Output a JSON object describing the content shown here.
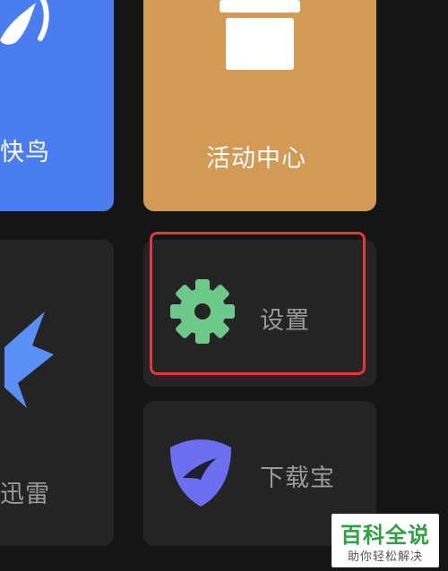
{
  "tiles": {
    "kuainiao": {
      "label": "快鸟",
      "icon": "kuainiao-bird-icon",
      "color": "#4a7ef0"
    },
    "activity": {
      "label": "活动中心",
      "icon": "gift-box-icon",
      "color": "#d39a55"
    },
    "xunlei": {
      "label": "迅雷",
      "icon": "xunlei-bird-icon",
      "color": "#242424"
    },
    "settings": {
      "label": "设置",
      "icon": "gear-icon",
      "accent": "#6dc98a"
    },
    "downloader": {
      "label": "下载宝",
      "icon": "download-shield-icon",
      "accent": "#6b6ff0"
    }
  },
  "highlight": {
    "color": "#e0393d"
  },
  "watermark": {
    "title": "百科全说",
    "subtitle": "助你轻松解决"
  }
}
